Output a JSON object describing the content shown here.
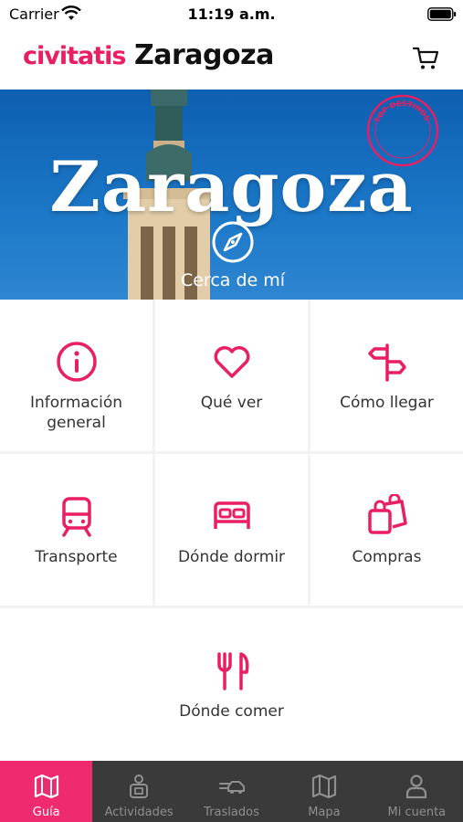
{
  "status_bar": {
    "carrier": "Carrier",
    "time": "11:19 a.m."
  },
  "header": {
    "brand": "civitatis",
    "city": "Zaragoza",
    "cart_icon": "shopping-cart-icon"
  },
  "hero": {
    "title": "Zaragoza",
    "badge_text": "TOP DESTINOS · CIVITATIS",
    "near_me_label": "Cerca de mí",
    "near_me_icon": "compass-icon"
  },
  "grid": {
    "tiles": [
      {
        "label": "Información\ngeneral",
        "icon": "info-icon"
      },
      {
        "label": "Qué ver",
        "icon": "heart-icon"
      },
      {
        "label": "Cómo llegar",
        "icon": "signpost-icon"
      },
      {
        "label": "Transporte",
        "icon": "train-icon"
      },
      {
        "label": "Dónde dormir",
        "icon": "bed-icon"
      },
      {
        "label": "Compras",
        "icon": "shopping-bags-icon"
      },
      {
        "label": "Dónde comer",
        "icon": "cutlery-icon"
      }
    ]
  },
  "tab_bar": {
    "tabs": [
      {
        "label": "Guía",
        "icon": "map-guide-icon",
        "active": true
      },
      {
        "label": "Actividades",
        "icon": "activities-icon",
        "active": false
      },
      {
        "label": "Traslados",
        "icon": "transfer-car-icon",
        "active": false
      },
      {
        "label": "Mapa",
        "icon": "map-icon",
        "active": false
      },
      {
        "label": "Mi cuenta",
        "icon": "user-icon",
        "active": false
      }
    ]
  },
  "colors": {
    "accent": "#e91e63",
    "tab_active_bg": "#ee2b6e",
    "tab_bar_bg": "#3a3a3a",
    "hero_sky": "#1c78c8"
  }
}
